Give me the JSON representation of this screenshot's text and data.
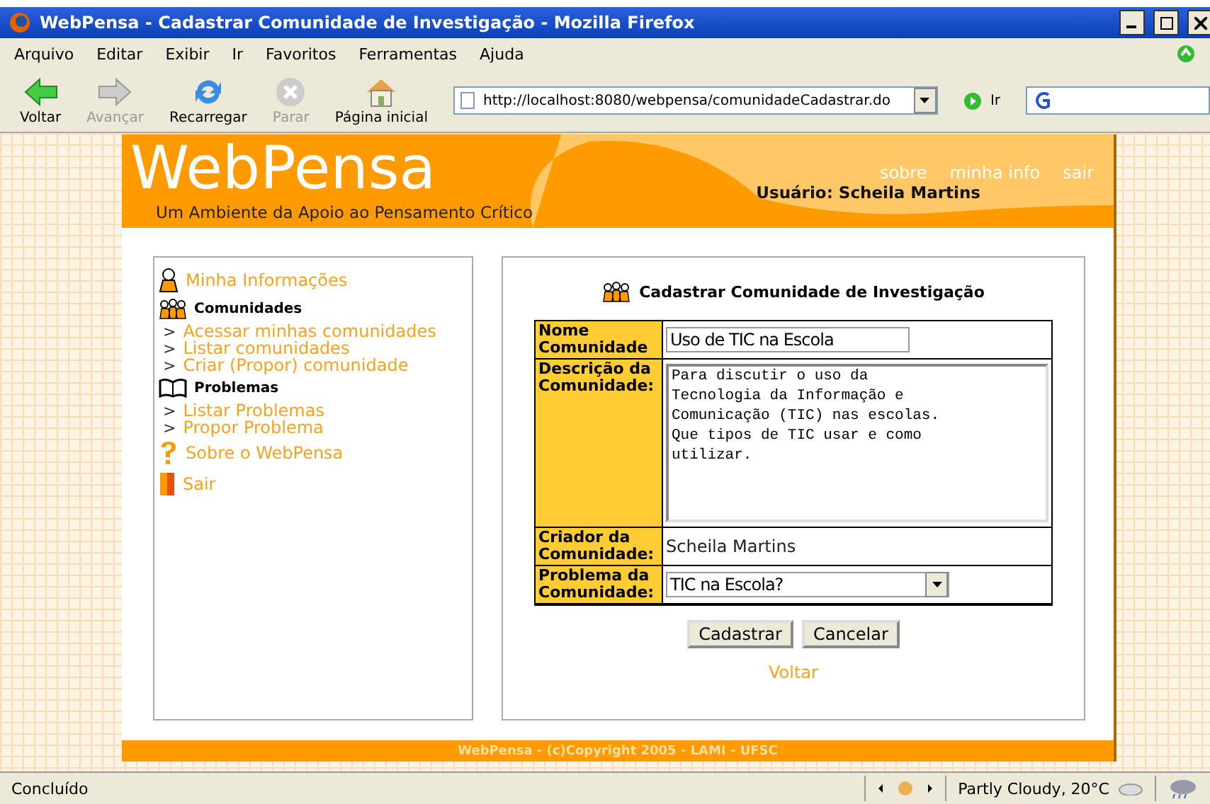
{
  "window": {
    "title": "WebPensa - Cadastrar Comunidade de Investigação - Mozilla Firefox"
  },
  "menu": [
    "Arquivo",
    "Editar",
    "Exibir",
    "Ir",
    "Favoritos",
    "Ferramentas",
    "Ajuda"
  ],
  "toolbar": [
    {
      "kind": "back",
      "label": "Voltar",
      "disabled": false
    },
    {
      "kind": "forward",
      "label": "Avançar",
      "disabled": true
    },
    {
      "kind": "reload",
      "label": "Recarregar",
      "disabled": false
    },
    {
      "kind": "stop",
      "label": "Parar",
      "disabled": true
    },
    {
      "kind": "home",
      "label": "Página inicial",
      "disabled": false
    }
  ],
  "address": {
    "value": "http://localhost:8080/webpensa/comunidadeCadastrar.do",
    "go_label": "Ir"
  },
  "header": {
    "logo": "WebPensa",
    "tagline": "Um Ambiente da Apoio ao Pensamento Crítico",
    "links": [
      "sobre",
      "minha info",
      "sair"
    ],
    "user": "Usuário: Scheila Martins"
  },
  "sidebar": [
    {
      "kind": "link",
      "label": "Minha Informações"
    },
    {
      "kind": "heading",
      "label": "Comunidades"
    },
    {
      "kind": "sublink",
      "marker": ">",
      "label": "Acessar minhas comunidades"
    },
    {
      "kind": "sublink",
      "marker": ">",
      "label": "Listar comunidades"
    },
    {
      "kind": "sublink",
      "marker": ">",
      "label": "Criar (Propor) comunidade"
    },
    {
      "kind": "heading",
      "label": "Problemas"
    },
    {
      "kind": "sublink",
      "marker": ">",
      "label": "Listar Problemas"
    },
    {
      "kind": "sublink",
      "marker": ">",
      "label": "Propor Problema"
    },
    {
      "kind": "link",
      "label": "Sobre o WebPensa"
    },
    {
      "kind": "link",
      "label": "Sair"
    }
  ],
  "form": {
    "title": "Cadastrar Comunidade de Investigação",
    "rows": [
      {
        "kind": "input",
        "label": "Nome Comunidade",
        "value": "Uso de TIC na Escola"
      },
      {
        "kind": "textarea",
        "label": "Descrição da Comunidade:",
        "value": "Para discutir o uso da\nTecnologia da Informação e\nComunicação (TIC) nas escolas.\nQue tipos de TIC usar e como\nutilizar."
      },
      {
        "kind": "text",
        "label": "Criador da Comunidade:",
        "value": "Scheila Martins"
      },
      {
        "kind": "select",
        "label": "Problema da Comunidade:",
        "value": "TIC na Escola?"
      }
    ],
    "buttons": [
      "Cadastrar",
      "Cancelar"
    ],
    "back_link": "Voltar"
  },
  "footer": "WebPensa - (c)Copyright 2005 - LAMI - UFSC",
  "status_bar": {
    "text": "Concluído",
    "weather": "Partly Cloudy, 20°C"
  }
}
